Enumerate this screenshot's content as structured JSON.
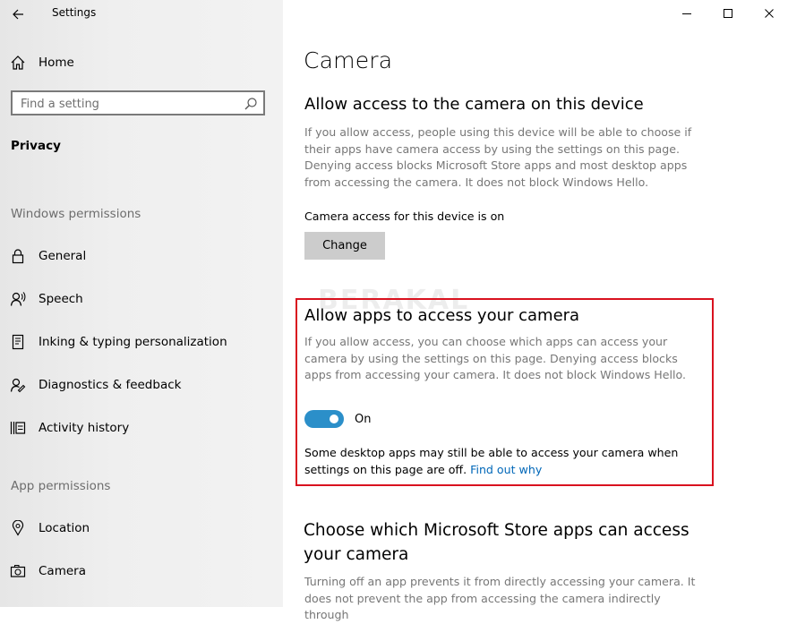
{
  "window": {
    "title": "Settings"
  },
  "sidebar": {
    "home_label": "Home",
    "search_placeholder": "Find a setting",
    "section_title": "Privacy",
    "windows_permissions_label": "Windows permissions",
    "windows_items": [
      {
        "label": "General",
        "icon": "lock-icon"
      },
      {
        "label": "Speech",
        "icon": "speech-icon"
      },
      {
        "label": "Inking & typing personalization",
        "icon": "inking-icon"
      },
      {
        "label": "Diagnostics & feedback",
        "icon": "diagnostics-icon"
      },
      {
        "label": "Activity history",
        "icon": "activity-history-icon"
      }
    ],
    "app_permissions_label": "App permissions",
    "app_items": [
      {
        "label": "Location",
        "icon": "location-icon"
      },
      {
        "label": "Camera",
        "icon": "camera-icon"
      }
    ]
  },
  "main": {
    "page_title": "Camera",
    "device_section": {
      "heading": "Allow access to the camera on this device",
      "description": "If you allow access, people using this device will be able to choose if their apps have camera access by using the settings on this page. Denying access blocks Microsoft Store apps and most desktop apps from accessing the camera. It does not block Windows Hello.",
      "status": "Camera access for this device is on",
      "change_button": "Change"
    },
    "apps_section": {
      "heading": "Allow apps to access your camera",
      "description": "If you allow access, you can choose which apps can access your camera by using the settings on this page. Denying access blocks apps from accessing your camera. It does not block Windows Hello.",
      "toggle_state": "On",
      "toggle_on": true,
      "note": "Some desktop apps may still be able to access your camera when settings on this page are off.",
      "link": "Find out why"
    },
    "store_section": {
      "heading": "Choose which Microsoft Store apps can access your camera",
      "description": "Turning off an app prevents it from directly accessing your camera. It does not prevent the app from accessing the camera indirectly through"
    },
    "watermark": "BERAKAL"
  },
  "colors": {
    "accent": "#2b8fc9",
    "link": "#0067b8",
    "highlight_border": "#d9121f",
    "button_bg": "#cccccc"
  }
}
